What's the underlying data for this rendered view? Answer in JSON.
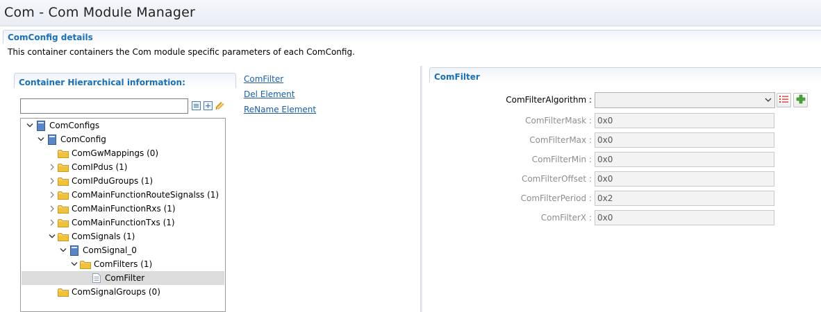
{
  "window": {
    "title": "Com - Com Module Manager"
  },
  "details": {
    "header": "ComConfig details",
    "description": "This container containers the Com module specific parameters of each ComConfig."
  },
  "hierarchy": {
    "header": "Container Hierarchical information:",
    "filter_value": "",
    "tree": [
      {
        "label": "ComConfigs",
        "level": 0,
        "expand": "expanded",
        "icon": "module-icon",
        "selected": false
      },
      {
        "label": "ComConfig",
        "level": 1,
        "expand": "expanded",
        "icon": "module-icon",
        "selected": false
      },
      {
        "label": "ComGwMappings (0)",
        "level": 2,
        "expand": "none",
        "icon": "folder-icon",
        "selected": false
      },
      {
        "label": "ComIPdus (1)",
        "level": 2,
        "expand": "collapsed",
        "icon": "folder-icon",
        "selected": false
      },
      {
        "label": "ComIPduGroups (1)",
        "level": 2,
        "expand": "collapsed",
        "icon": "folder-icon",
        "selected": false
      },
      {
        "label": "ComMainFunctionRouteSignalss (1)",
        "level": 2,
        "expand": "collapsed",
        "icon": "folder-icon",
        "selected": false
      },
      {
        "label": "ComMainFunctionRxs (1)",
        "level": 2,
        "expand": "collapsed",
        "icon": "folder-icon",
        "selected": false
      },
      {
        "label": "ComMainFunctionTxs (1)",
        "level": 2,
        "expand": "collapsed",
        "icon": "folder-icon",
        "selected": false
      },
      {
        "label": "ComSignals (1)",
        "level": 2,
        "expand": "expanded",
        "icon": "folder-icon",
        "selected": false
      },
      {
        "label": "ComSignal_0",
        "level": 3,
        "expand": "expanded",
        "icon": "module-icon",
        "selected": false
      },
      {
        "label": "ComFilters (1)",
        "level": 4,
        "expand": "expanded",
        "icon": "folder-icon",
        "selected": false
      },
      {
        "label": "ComFilter",
        "level": 5,
        "expand": "none",
        "icon": "file-icon",
        "selected": true
      },
      {
        "label": "ComSignalGroups (0)",
        "level": 2,
        "expand": "none",
        "icon": "folder-icon",
        "selected": false
      }
    ]
  },
  "links": {
    "filter": "ComFilter",
    "del_element": "Del Element",
    "rename_element": "ReName Element"
  },
  "filter_panel": {
    "header": "ComFilter",
    "algorithm_label": "ComFilterAlgorithm :",
    "algorithm_value": "",
    "params": [
      {
        "label": "ComFilterMask :",
        "value": "0x0"
      },
      {
        "label": "ComFilterMax :",
        "value": "0x0"
      },
      {
        "label": "ComFilterMin :",
        "value": "0x0"
      },
      {
        "label": "ComFilterOffset :",
        "value": "0x0"
      },
      {
        "label": "ComFilterPeriod :",
        "value": "0x2"
      },
      {
        "label": "ComFilterX :",
        "value": "0x0"
      }
    ]
  },
  "colors": {
    "section_header_text": "#1a6fb5",
    "link": "#1a5ea8",
    "selected_row": "#dcdcdc",
    "folder": "#f0c23b"
  }
}
